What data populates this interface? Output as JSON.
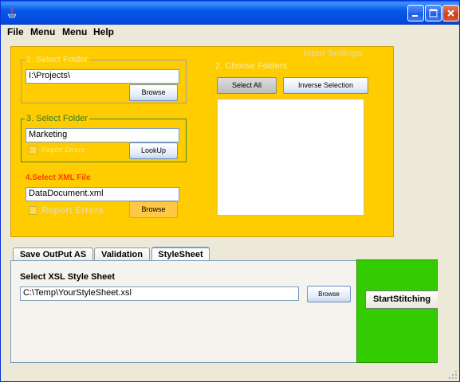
{
  "window": {
    "icon": "java-icon",
    "controls": [
      "minimize-icon",
      "maximize-icon",
      "close-icon"
    ]
  },
  "menu": [
    "File",
    "Menu",
    "Menu",
    "Help"
  ],
  "panel": {
    "title": "Input Settings",
    "select_folder_1": {
      "legend": "1. Select Folder",
      "value": "I:\\Projects\\",
      "button": "Browse"
    },
    "select_folder_3": {
      "legend": "3. Select Folder",
      "value": "Marketing",
      "checkbox": "Report Errors",
      "button": "LookUp"
    },
    "select_xml": {
      "legend": "4.Select XML File",
      "value": "DataDocument.xml",
      "checkbox": "Report Errors",
      "button": "Browse"
    },
    "choose_folders": {
      "legend": "2. Choose Folders",
      "select_all": "Select All",
      "inverse": "Inverse Selection",
      "items": []
    }
  },
  "tabs": [
    {
      "label": "Save OutPut AS",
      "active": false
    },
    {
      "label": "Validation",
      "active": false
    },
    {
      "label": "StyleSheet",
      "active": true
    }
  ],
  "stylesheet": {
    "label": "Select XSL Style Sheet",
    "value": "C:\\Temp\\YourStyleSheet.xsl",
    "button": "Browse"
  },
  "action": {
    "label": "StartStitching"
  },
  "colors": {
    "panel": "#ffcc00",
    "action_panel": "#33cc00",
    "titlebar": "#0758e8"
  }
}
